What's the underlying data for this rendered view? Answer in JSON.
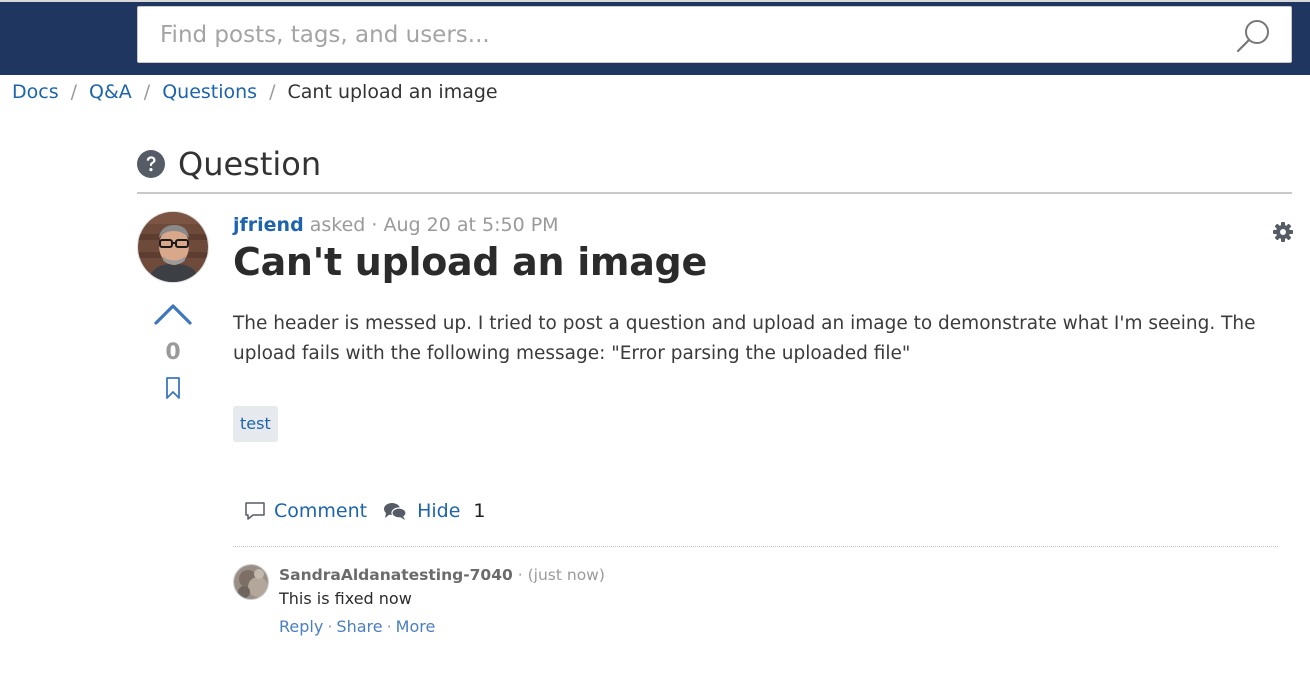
{
  "search": {
    "placeholder": "Find posts, tags, and users..."
  },
  "breadcrumb": [
    {
      "label": "Docs"
    },
    {
      "label": "Q&A"
    },
    {
      "label": "Questions"
    },
    {
      "label": "Cant upload an image"
    }
  ],
  "section": {
    "title": "Question"
  },
  "question": {
    "author": "jfriend",
    "asked_label": "asked",
    "timestamp": "Aug 20 at 5:50 PM",
    "title": "Can't upload an image",
    "body": "The header is messed up. I tried to post a question and upload an image to demonstrate what I'm seeing. The upload fails with the following message: \"Error parsing the uploaded file\"",
    "votes": "0",
    "tags": [
      "test"
    ]
  },
  "actions": {
    "comment_label": "Comment",
    "hide_label": "Hide",
    "comment_count": "1"
  },
  "comment": {
    "author": "SandraAldanatesting-7040",
    "time": "(just now)",
    "text": "This is fixed now",
    "reply_label": "Reply",
    "share_label": "Share",
    "more_label": "More"
  },
  "colors": {
    "header_bg": "#1f3660",
    "link": "#1e64ad",
    "muted": "#9a9a9a",
    "tag_bg": "#e6eaee"
  }
}
